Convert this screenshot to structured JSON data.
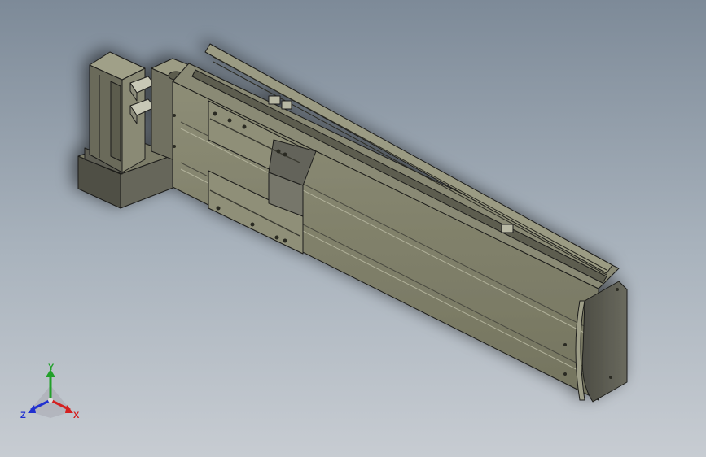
{
  "viewport": {
    "background_top": "#7d8a98",
    "background_bottom": "#c7ccd2"
  },
  "model": {
    "body_color": "#7f7f69",
    "body_dark": "#56574a",
    "body_light": "#9e9e86",
    "edge_color": "#1e1e1a",
    "motor_color": "#8a8a74",
    "end_cap_color": "#585850"
  },
  "triad": {
    "x_label": "X",
    "y_label": "Y",
    "z_label": "Z",
    "x_color": "#d42020",
    "y_color": "#22a02a",
    "z_color": "#2030d0"
  }
}
